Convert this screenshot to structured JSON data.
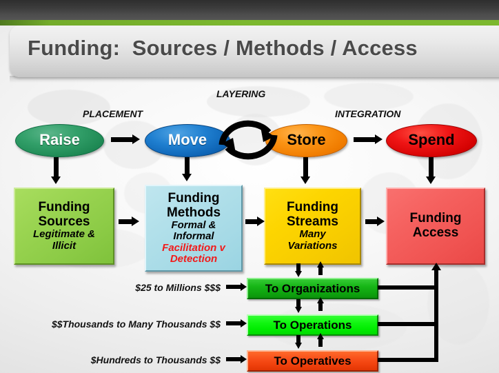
{
  "header": {
    "title": "Funding:  Sources / Methods / Access",
    "accent_color": "#7cb82f",
    "panel_color": "#e4e4e4"
  },
  "diagram": {
    "stage_labels": [
      {
        "name": "placement",
        "text": "PLACEMENT"
      },
      {
        "name": "layering",
        "text": "LAYERING"
      },
      {
        "name": "integration",
        "text": "INTEGRATION"
      }
    ],
    "stages": [
      {
        "name": "raise",
        "label": "Raise",
        "color": "#1f8a55",
        "text_color": "#ffffff"
      },
      {
        "name": "move",
        "label": "Move",
        "color": "#0d63b4",
        "text_color": "#ffffff"
      },
      {
        "name": "store",
        "label": "Store",
        "color": "#f07c00",
        "text_color": "#000000"
      },
      {
        "name": "spend",
        "label": "Spend",
        "color": "#d40202",
        "text_color": "#000000"
      }
    ],
    "boxes": [
      {
        "name": "funding-sources",
        "title_line1": "Funding",
        "title_line2": "Sources",
        "sub_line1": "Legitimate &",
        "sub_line2": "Illicit",
        "color": "#8ccb46"
      },
      {
        "name": "funding-methods",
        "title_line1": "Funding",
        "title_line2": "Methods",
        "sub_line1": "Formal &",
        "sub_line2": "Informal",
        "sub_red_line1": "Facilitation v",
        "sub_red_line2": "Detection",
        "color": "#a6dae6",
        "red_color": "#f21a1a"
      },
      {
        "name": "funding-streams",
        "title_line1": "Funding",
        "title_line2": "Streams",
        "sub_line1": "Many",
        "sub_line2": "Variations",
        "color": "#f7cc00"
      },
      {
        "name": "funding-access",
        "title_line1": "Funding",
        "title_line2": "Access",
        "color": "#f05452"
      }
    ],
    "flows": [
      {
        "name": "to-organizations",
        "amount_label": "$25 to Millions $$$",
        "target_label": "To Organizations",
        "color": "#0fa50f"
      },
      {
        "name": "to-operations",
        "amount_label": "$$Thousands to Many Thousands $$",
        "target_label": "To Operations",
        "color": "#00ec00"
      },
      {
        "name": "to-operatives",
        "amount_label": "$Hundreds to Thousands $$",
        "target_label": "To Operatives",
        "color": "#ef400c"
      }
    ]
  }
}
